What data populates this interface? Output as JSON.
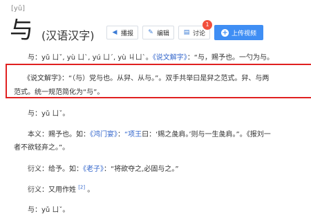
{
  "header": {
    "pinyin": "[yǔ]",
    "character": "与",
    "subtitle": "(汉语汉字)"
  },
  "toolbar": {
    "buttons": [
      {
        "label": "播报",
        "icon": "speaker-icon"
      },
      {
        "label": "编辑",
        "icon": "pencil-icon"
      },
      {
        "label": "讨论",
        "icon": "chat-icon",
        "badge": "1"
      }
    ],
    "upload_label": "上传视频"
  },
  "content": {
    "line1": {
      "prefix": "与：yǔ ㄩˇ, yù ㄩˋ, yú ㄩˊ, yù ㄐㄩˋ。",
      "link": "《说文解字》",
      "suffix": "：“与，赐予也。一勺为与。"
    },
    "line2": "《说文解字》：“（与）党与也。从舁、从与。”。双手共举曰是舁之范式。舁、与两",
    "line3": "范式。统一规范简化为“与”。",
    "line4": "与：yǔ ㄩˇ。",
    "line5": {
      "prefix": "本义：赐予也。如：",
      "link1": "《鸿门宴》",
      "middle": "：",
      "link2": "“项王",
      "suffix": "曰：‘赐之彘肩。’则与一生彘肩。”。《报刘一"
    },
    "line6": "者不欲轻弃之。”。",
    "line7": {
      "prefix": "衍义：给予。如：",
      "link": "《老子》",
      "suffix": "：“将欲夺之,必固与之。”"
    },
    "line8": {
      "text": "衍义：又用作姓",
      "sup": "[2]",
      "end": "。"
    },
    "line9": "与：yǔ ㄩˇ。"
  },
  "accent": {
    "link": "#3366cc",
    "highlight": "#e02020",
    "primary": "#3f8ef4"
  }
}
